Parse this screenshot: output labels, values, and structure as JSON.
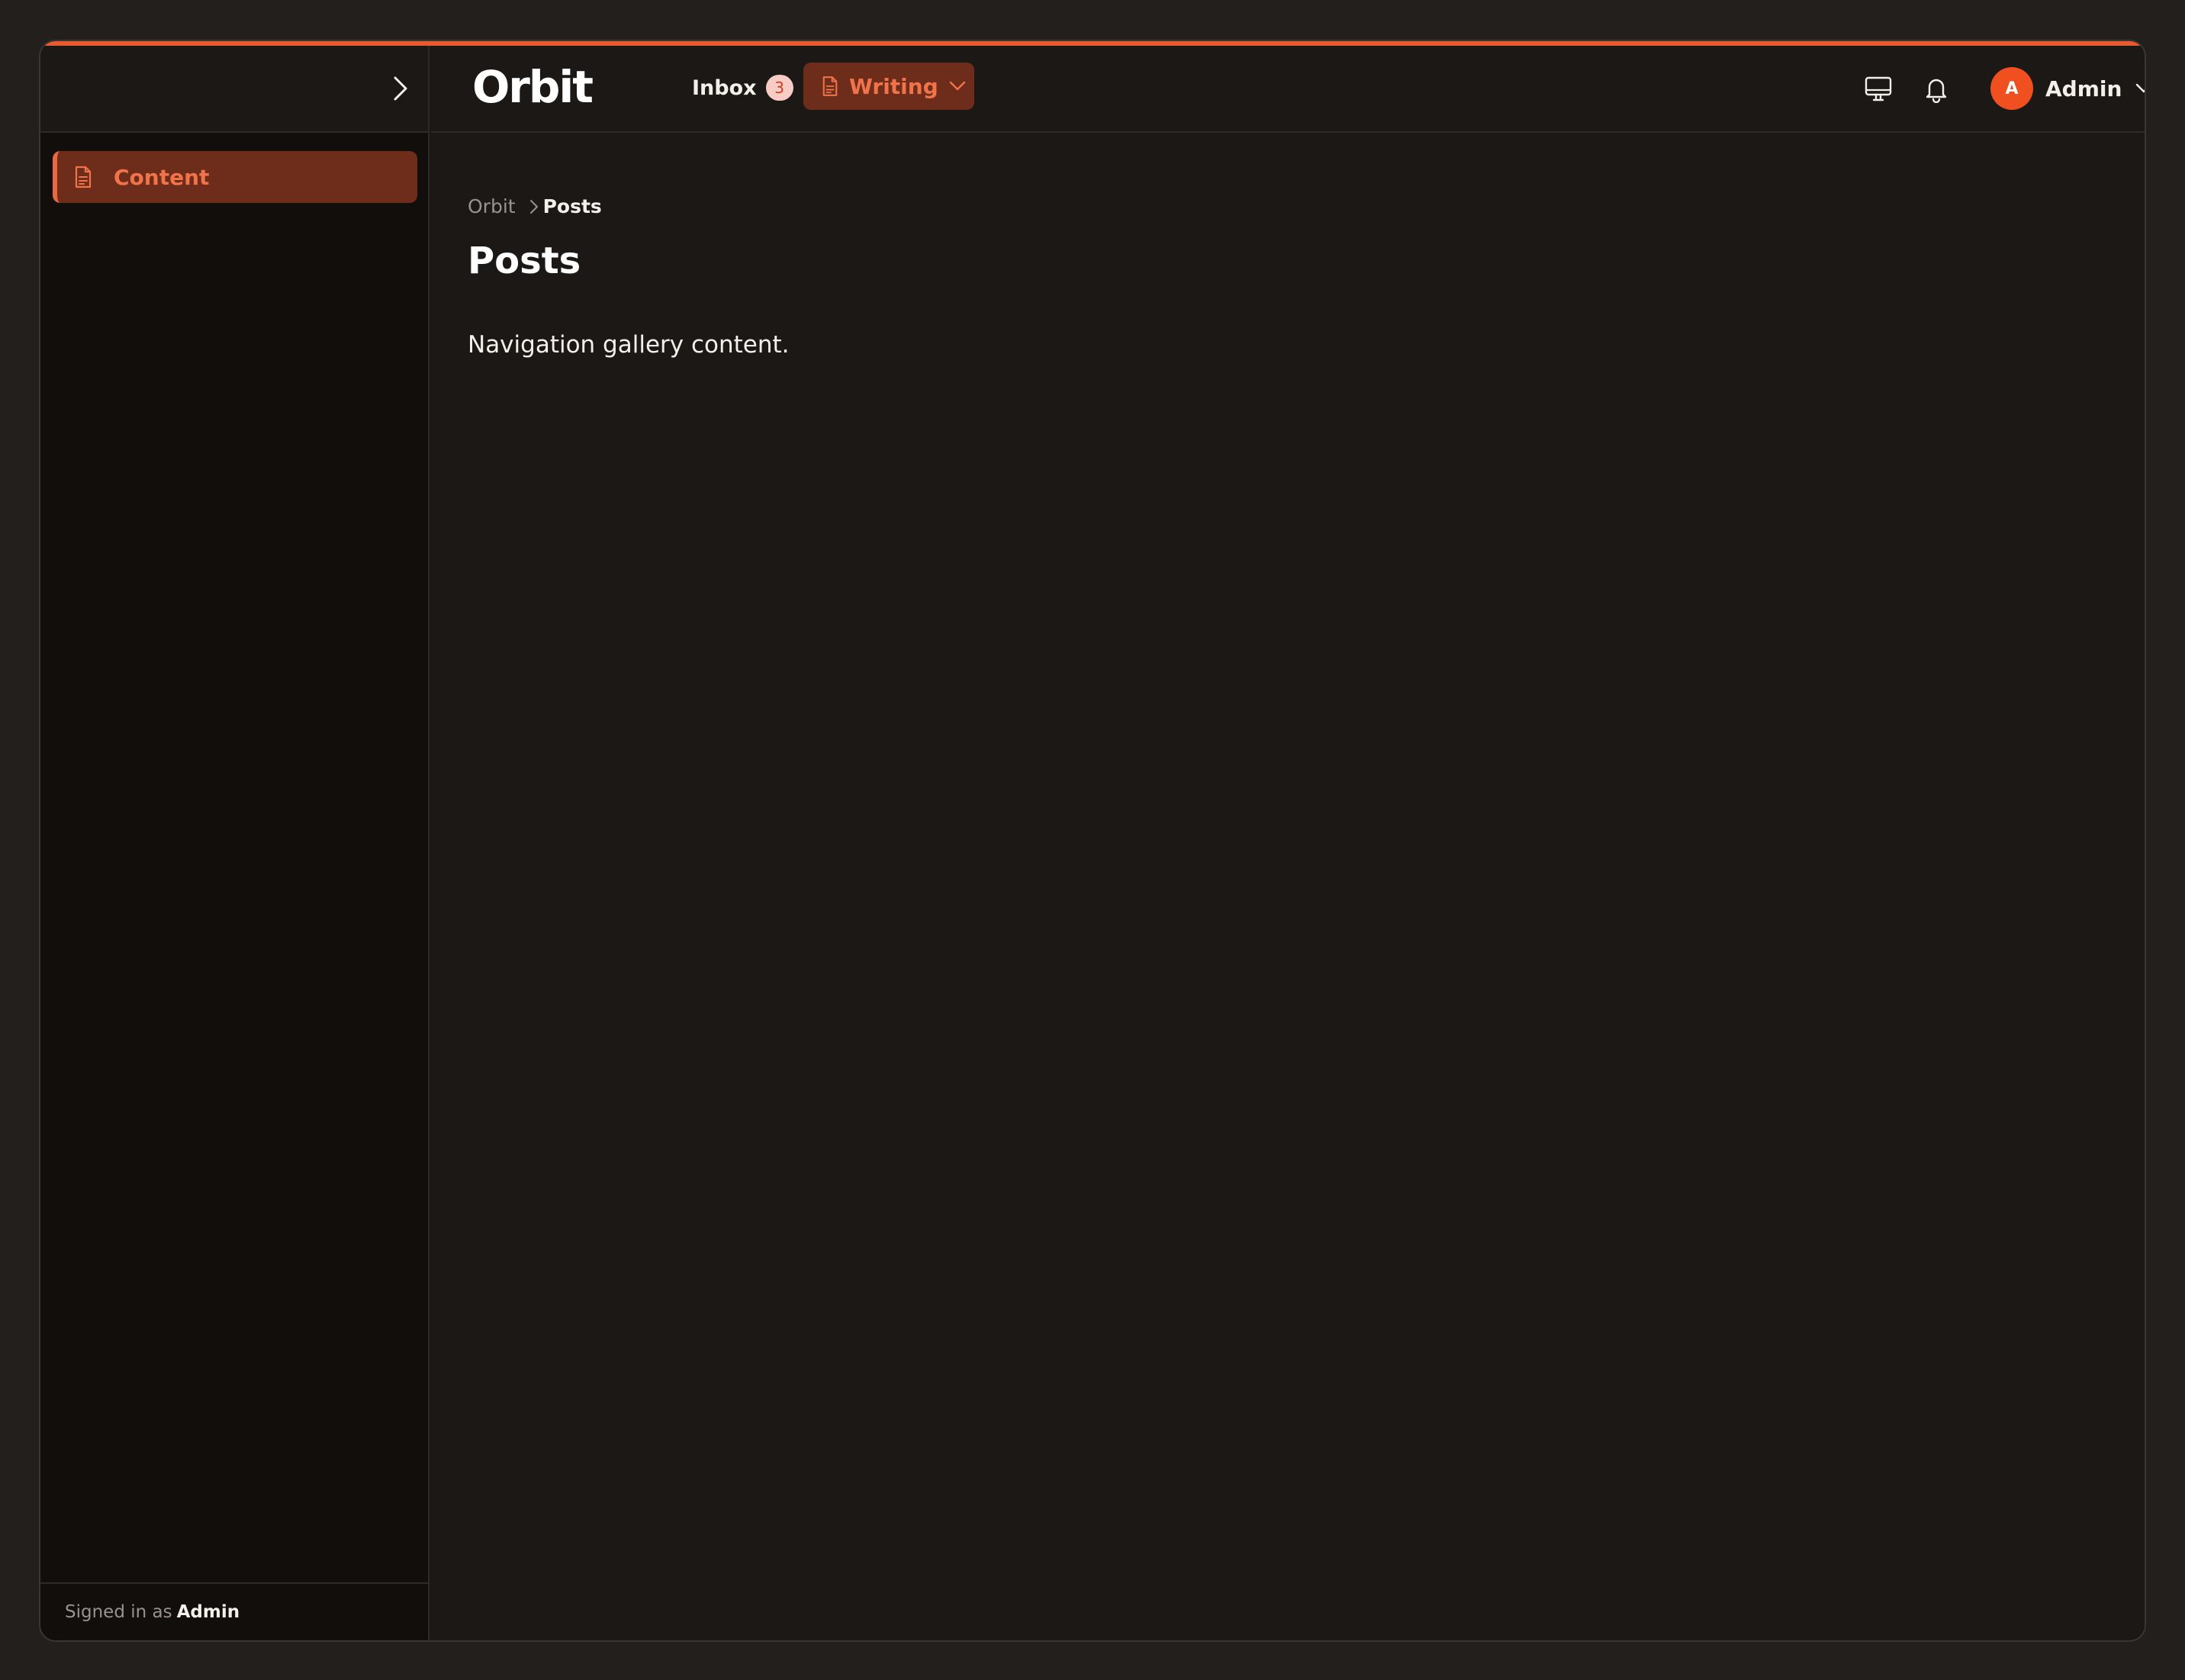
{
  "brand": {
    "name": "Orbit",
    "accent_color": "#e85a2f"
  },
  "topbar": {
    "inbox_label": "Inbox",
    "inbox_count": "3",
    "writing_label": "Writing",
    "writing_icon": "document-icon",
    "icons": [
      "monitor-icon",
      "bell-icon"
    ],
    "user": {
      "initial": "A",
      "name": "Admin"
    }
  },
  "sidebar": {
    "collapse_icon": "chevron-right-icon",
    "items": [
      {
        "label": "Content",
        "icon": "document-icon",
        "active": true
      }
    ],
    "footer": {
      "prefix": "Signed in as",
      "user": "Admin"
    }
  },
  "main": {
    "breadcrumb": [
      "Orbit",
      "Posts"
    ],
    "title": "Posts",
    "body": "Navigation gallery content."
  }
}
